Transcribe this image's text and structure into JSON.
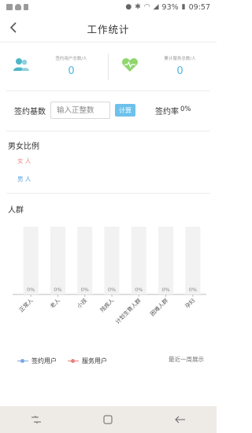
{
  "status_bar": {
    "battery": "93%",
    "time": "09:57",
    "icons": [
      "location-icon",
      "bluetooth-icon",
      "wifi-icon",
      "signal-icon",
      "battery-icon"
    ]
  },
  "header": {
    "title": "工作统计",
    "back_icon": "chevron-left-icon"
  },
  "stats": [
    {
      "label": "签约用户总数/人",
      "value": "0",
      "icon": "users-icon",
      "color": "#4db6c7"
    },
    {
      "label": "累计服务总数/人",
      "value": "0",
      "icon": "heart-icon",
      "color": "#8fd66d"
    }
  ],
  "calculator": {
    "label": "签约基数",
    "input_placeholder": "输入正整数",
    "button_label": "计算",
    "rate_label": "签约率",
    "rate_value": "0%"
  },
  "gender": {
    "title": "男女比例",
    "female_label": "女 人",
    "male_label": "男 人"
  },
  "crowd": {
    "title": "人群"
  },
  "chart_data": {
    "type": "bar",
    "categories": [
      "正常人",
      "老人",
      "小孩",
      "残疾人",
      "计划生育人群",
      "困难人群",
      "孕妇"
    ],
    "values": [
      0,
      0,
      0,
      0,
      0,
      0,
      0
    ],
    "value_labels": [
      "0%",
      "0%",
      "0%",
      "0%",
      "0%",
      "0%",
      "0%"
    ],
    "bar_background": "#f2f2f2"
  },
  "legend": {
    "sign_label": "签约用户",
    "service_label": "服务用户",
    "sign_color": "#7aa7e0",
    "service_color": "#e97f7a",
    "recent_label": "最近一周展示"
  },
  "nav_bar": {
    "icons": [
      "recent-apps-icon",
      "home-icon",
      "back-icon"
    ]
  }
}
